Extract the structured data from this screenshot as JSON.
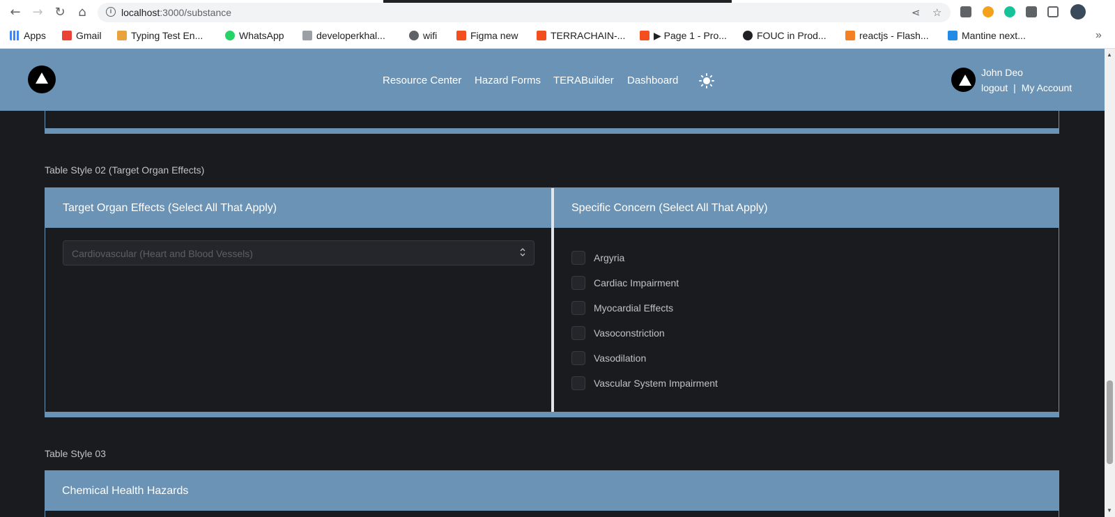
{
  "browser": {
    "url_host": "localhost",
    "url_path": ":3000/substance",
    "bookmarks": [
      {
        "label": "Apps",
        "color": "#4285f4"
      },
      {
        "label": "Gmail",
        "color": "#ea4335"
      },
      {
        "label": "Typing Test En...",
        "color": "#e8a33d"
      },
      {
        "label": "WhatsApp",
        "color": "#25d366"
      },
      {
        "label": "developerkhal...",
        "color": "#9aa0a6"
      },
      {
        "label": "wifi",
        "color": "#5f6368"
      },
      {
        "label": "Figma new",
        "color": "#f24e1e"
      },
      {
        "label": "TERRACHAIN-...",
        "color": "#f24e1e"
      },
      {
        "label": "▶ Page 1 - Pro...",
        "color": "#f24e1e"
      },
      {
        "label": "FOUC in Prod...",
        "color": "#202124"
      },
      {
        "label": "reactjs - Flash...",
        "color": "#f48024"
      },
      {
        "label": "Mantine next...",
        "color": "#228be6"
      }
    ],
    "more": "»"
  },
  "header": {
    "nav": [
      "Resource Center",
      "Hazard Forms",
      "TERABuilder",
      "Dashboard"
    ],
    "user_name": "John Deo",
    "logout": "logout",
    "separator": "|",
    "my_account": "My Account",
    "accent": "#6b93b5"
  },
  "sections": {
    "style02_label": "Table Style 02 (Target Organ Effects)",
    "style03_label": "Table Style 03"
  },
  "table02": {
    "col1_header": "Target Organ Effects (Select All That Apply)",
    "col2_header": "Specific Concern (Select All That Apply)",
    "select_value": "Cardiovascular (Heart and Blood Vessels)",
    "concerns": [
      "Argyria",
      "Cardiac Impairment",
      "Myocardial Effects",
      "Vasoconstriction",
      "Vasodilation",
      "Vascular System Impairment"
    ]
  },
  "table03": {
    "header": "Chemical Health Hazards"
  }
}
